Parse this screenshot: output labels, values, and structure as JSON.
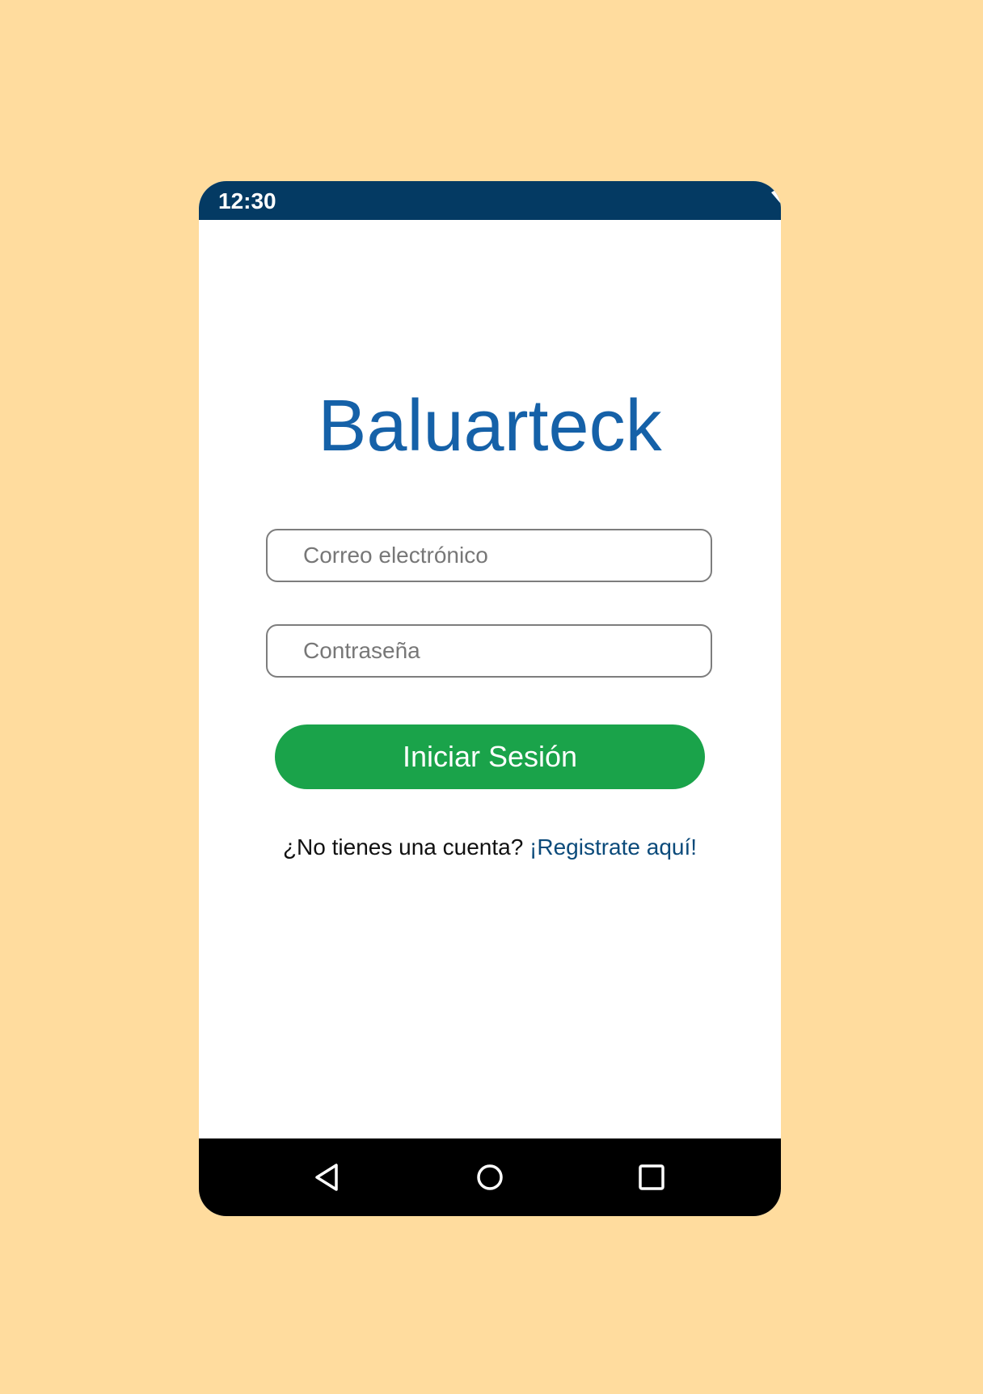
{
  "status_bar": {
    "time": "12:30",
    "icons": [
      "wifi-icon",
      "signal-icon",
      "battery-icon"
    ],
    "background_color": "#043a63"
  },
  "app": {
    "title": "Baluarteck",
    "title_color": "#1561a8"
  },
  "form": {
    "email_placeholder": "Correo electrónico",
    "email_value": "",
    "password_placeholder": "Contraseña",
    "password_value": "",
    "login_label": "Iniciar Sesión",
    "login_color": "#1aa34a"
  },
  "register": {
    "prompt": "¿No tienes una cuenta?",
    "link_label": "¡Registrate aquí!",
    "link_color": "#0b4a7a"
  },
  "nav_bar": {
    "icons": [
      "back-icon",
      "home-icon",
      "recents-icon"
    ],
    "background_color": "#000000"
  },
  "page_background": "#ffdc9e"
}
